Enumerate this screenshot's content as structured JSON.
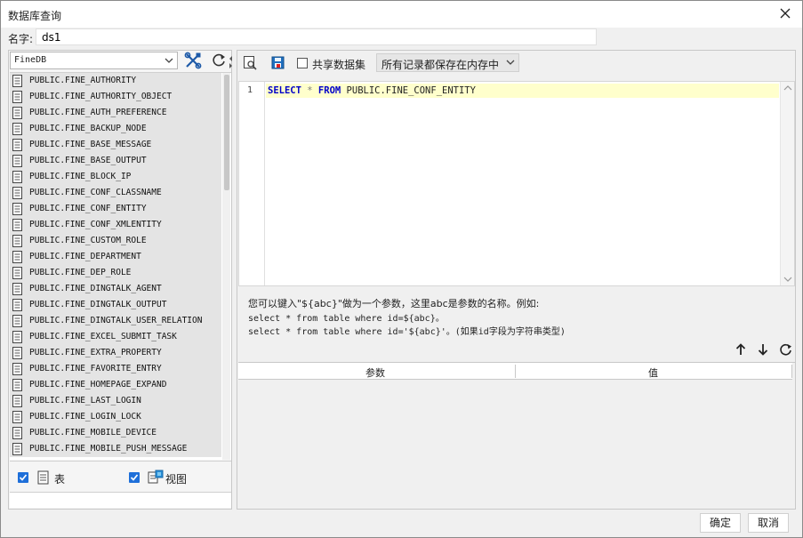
{
  "window": {
    "title": "数据库查询"
  },
  "name_field": {
    "label": "名字:",
    "value": "ds1"
  },
  "left": {
    "database": "FineDB",
    "tables": [
      "PUBLIC.FINE_AUTHORITY",
      "PUBLIC.FINE_AUTHORITY_OBJECT",
      "PUBLIC.FINE_AUTH_PREFERENCE",
      "PUBLIC.FINE_BACKUP_NODE",
      "PUBLIC.FINE_BASE_MESSAGE",
      "PUBLIC.FINE_BASE_OUTPUT",
      "PUBLIC.FINE_BLOCK_IP",
      "PUBLIC.FINE_CONF_CLASSNAME",
      "PUBLIC.FINE_CONF_ENTITY",
      "PUBLIC.FINE_CONF_XMLENTITY",
      "PUBLIC.FINE_CUSTOM_ROLE",
      "PUBLIC.FINE_DEPARTMENT",
      "PUBLIC.FINE_DEP_ROLE",
      "PUBLIC.FINE_DINGTALK_AGENT",
      "PUBLIC.FINE_DINGTALK_OUTPUT",
      "PUBLIC.FINE_DINGTALK_USER_RELATION",
      "PUBLIC.FINE_EXCEL_SUBMIT_TASK",
      "PUBLIC.FINE_EXTRA_PROPERTY",
      "PUBLIC.FINE_FAVORITE_ENTRY",
      "PUBLIC.FINE_HOMEPAGE_EXPAND",
      "PUBLIC.FINE_LAST_LOGIN",
      "PUBLIC.FINE_LOGIN_LOCK",
      "PUBLIC.FINE_MOBILE_DEVICE",
      "PUBLIC.FINE_MOBILE_PUSH_MESSAGE"
    ],
    "show_tables_label": "表",
    "show_views_label": "视图",
    "show_tables_checked": true,
    "show_views_checked": true
  },
  "toolbar": {
    "share_dataset_label": "共享数据集",
    "share_dataset_checked": false,
    "storage_mode": "所有记录都保存在内存中"
  },
  "editor": {
    "line_number": "1",
    "sql": {
      "kw_select": "SELECT",
      "star": "*",
      "kw_from": "FROM",
      "table": "PUBLIC.FINE_CONF_ENTITY"
    }
  },
  "hint": {
    "line1": "您可以键入\"${abc}\"做为一个参数，这里abc是参数的名称。例如:",
    "line2": "select * from table where id=${abc}。",
    "line3": "select * from table where id='${abc}'。(如果id字段为字符串类型)"
  },
  "params": {
    "col_param": "参数",
    "col_value": "值"
  },
  "footer": {
    "ok_label": "确定",
    "cancel_label": "取消"
  },
  "colors": {
    "check_blue": "#1e6fd9",
    "highlight_line": "#ffffcc",
    "sql_keyword": "#0000c8"
  }
}
